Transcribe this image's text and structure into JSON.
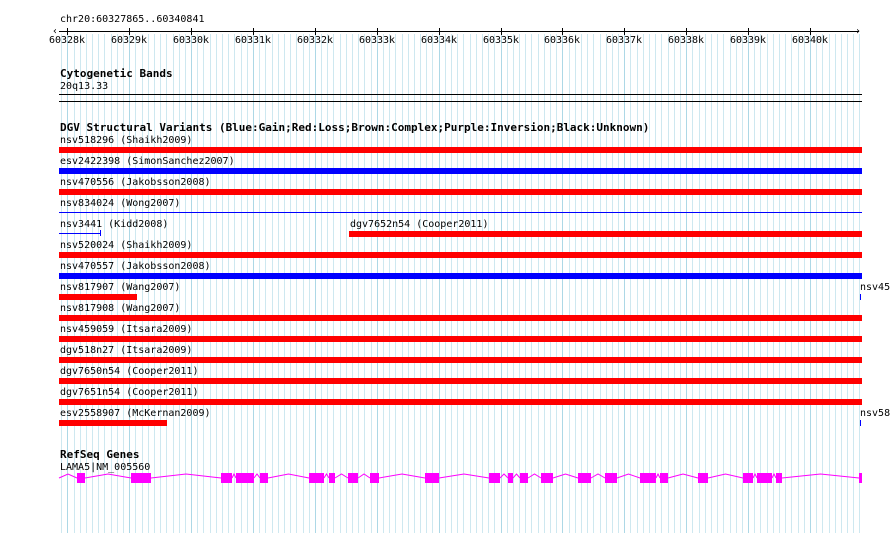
{
  "ruler": {
    "location": "chr20:60327865..60340841",
    "labels": [
      "60328k",
      "60329k",
      "60330k",
      "60331k",
      "60332k",
      "60333k",
      "60334k",
      "60335k",
      "60336k",
      "60337k",
      "60338k",
      "60339k",
      "60340k"
    ]
  },
  "cytoband": {
    "title": "Cytogenetic Bands",
    "band": "20q13.33"
  },
  "dgv": {
    "title": "DGV Structural Variants (Blue:Gain;Red:Loss;Brown:Complex;Purple:Inversion;Black:Unknown)",
    "rows": [
      {
        "label": "nsv518296 (Shaikh2009)"
      },
      {
        "label": "esv2422398 (SimonSanchez2007)"
      },
      {
        "label": "nsv470556 (Jakobsson2008)"
      },
      {
        "label": "nsv834024 (Wong2007)"
      },
      {
        "label": "nsv3441 (Kidd2008)",
        "label2": "dgv7652n54 (Cooper2011)"
      },
      {
        "label": "nsv520024 (Shaikh2009)"
      },
      {
        "label": "nsv470557 (Jakobsson2008)"
      },
      {
        "label": "nsv817907 (Wang2007)",
        "label2": "nsv45"
      },
      {
        "label": "nsv817908 (Wang2007)"
      },
      {
        "label": "nsv459059 (Itsara2009)"
      },
      {
        "label": "dgv518n27 (Itsara2009)"
      },
      {
        "label": "dgv7650n54 (Cooper2011)"
      },
      {
        "label": "dgv7651n54 (Cooper2011)"
      },
      {
        "label": "esv2558907 (McKernan2009)",
        "label2": "nsv58"
      }
    ]
  },
  "refseq": {
    "title": "RefSeq Genes",
    "gene": "LAMA5|NM_005560"
  },
  "colors": {
    "loss": "#ff0000",
    "gain": "#0000ff",
    "gridline": "#add8e6",
    "exon": "#ff00ff"
  }
}
